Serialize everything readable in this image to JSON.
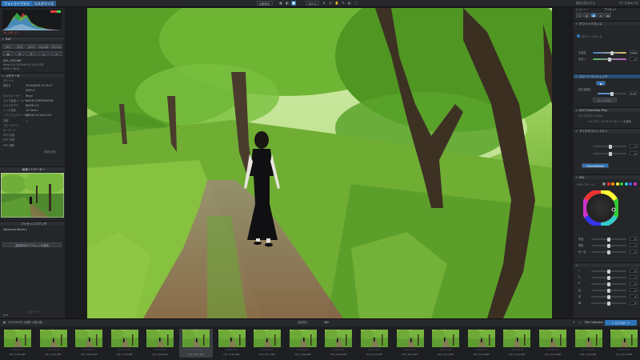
{
  "topbar": {
    "tabs": [
      "フォトライブラリ",
      "カスタマイズ"
    ],
    "ellipsis": "…",
    "toolbar_buttons": [
      "比較表示",
      "100 %"
    ],
    "zoom_label": "100 %",
    "right_tabs": [
      "補正を表示する",
      "ワークスペース"
    ],
    "icons": [
      "grid-icon",
      "compare-icon",
      "crop-icon",
      "rotate-icon",
      "hand-icon",
      "picker-icon"
    ]
  },
  "left_panel": {
    "histogram_readout": "34, 100, 17",
    "histogram_colors": [
      "#e83d3d",
      "#3ddc55",
      "#3d7de8",
      "#f0f0f0"
    ],
    "exif_section": "Exif",
    "shooting_modes": [
      "ISO 100",
      "1/13",
      "f/4.0",
      "24-105",
      "EV 0.0"
    ],
    "mode_buttons": [
      "",
      "",
      "",
      "",
      ""
    ],
    "file_name": "DSF_4701.RAF",
    "file_info": "Nikon Z 6  2019:06:14  14:12:28",
    "resolution": "6048 x 4024",
    "meta_section": "メタデータ",
    "meta_rows": [
      {
        "label": "タイトル",
        "value": ""
      },
      {
        "label": "撮影日",
        "value": "2019/06/08  15:03:17"
      },
      {
        "label": "",
        "value": "DXP+0"
      },
      {
        "label": "カメラメーカー",
        "value": "Nikon"
      },
      {
        "label": "カメラ製造メーカー",
        "value": "NIKON CORPORATION"
      },
      {
        "label": "カメラモデル",
        "value": "NIKON Z 6"
      },
      {
        "label": "レンズ名称",
        "value": "24-70mm"
      },
      {
        "label": "ソフトウェアバージョン",
        "value": "NIKON Z 6 Ver.01.00"
      },
      {
        "label": "評価",
        "value": "—"
      },
      {
        "label": "コピーライト",
        "value": ""
      },
      {
        "label": "キーワード",
        "value": ""
      },
      {
        "label": "IPTC 作者",
        "value": ""
      },
      {
        "label": "IPTC 作成",
        "value": ""
      },
      {
        "label": "IPTC 場所",
        "value": ""
      }
    ],
    "more_link": "詳細を表示",
    "navigator_title": "画像ナビゲーター",
    "preset_title": "プリセットエディタ",
    "preset_dropdown": "Advanced Helvet",
    "preset_button": "選択済みのプリセットを適用",
    "footer_tabs": [
      "Exif",
      "ヒストリー"
    ]
  },
  "right_panel": {
    "top_tabs": [
      "ヒストリー",
      "プリセット"
    ],
    "mode_tabs": [
      "",
      "",
      "",
      "",
      ""
    ],
    "sections": {
      "wb": "ホワイトバランス",
      "wb_checkbox": "ホワイトバランス",
      "wb_temp": "5400",
      "wb_tint": "0",
      "wb_labels": [
        "色温度",
        "色合い"
      ],
      "tone": "スマートライティング",
      "exposure": "露光量補正",
      "exp_value": "0.00",
      "contrast": "コントラスト",
      "highlights": "マイクロコントラスト",
      "clarity_labels": [
        "DxO ClearView Plus",
        "マイクロコントラスト",
        "シャドウ・ハイライトのトーンを保持"
      ],
      "hsl": "HSL",
      "hsl_mode": "ChannelSelect",
      "color_wheel_label": "カラーホイール",
      "hsl_sliders": [
        "彩度",
        "輝度",
        "均一性"
      ],
      "hsl_values": [
        "0",
        "0",
        "0"
      ],
      "color_sliders": [
        "L",
        "A",
        "B",
        "色",
        "彩",
        "輝"
      ],
      "color_values": [
        "0",
        "0",
        "0",
        "0",
        "0",
        "0"
      ]
    }
  },
  "filmstrip": {
    "path": "2019/06/08 大阪府 大阪公園 ...",
    "count_label": "画像表示",
    "count": "181",
    "collection_label": "Film Collection",
    "export_button": "エクスポート",
    "thumbs": [
      {
        "cap": "DSF_4700.NEF",
        "sel": false
      },
      {
        "cap": "DSF_4701.NEF",
        "sel": false
      },
      {
        "cap": "DSF_4702.NEF",
        "sel": false
      },
      {
        "cap": "DSF_4703.NEF",
        "sel": false
      },
      {
        "cap": "DSF_4704.NEF",
        "sel": false
      },
      {
        "cap": "DSF_4705.NEF",
        "sel": true
      },
      {
        "cap": "DSF_4706.NEF",
        "sel": false
      },
      {
        "cap": "DSF_4707.NEF",
        "sel": false
      },
      {
        "cap": "DSF_4708.NEF",
        "sel": false
      },
      {
        "cap": "DSF_4709.NEF",
        "sel": false
      },
      {
        "cap": "DSF_4710.NEF",
        "sel": false
      },
      {
        "cap": "DSF_4711.NEF",
        "sel": false
      },
      {
        "cap": "DSF_4712.NEF",
        "sel": false
      },
      {
        "cap": "DSF_4713.NEF",
        "sel": false
      },
      {
        "cap": "DSF_4714.NEF",
        "sel": false
      },
      {
        "cap": "DSF_4715.NEF",
        "sel": false
      },
      {
        "cap": "DSF_4716.NEF",
        "sel": false
      },
      {
        "cap": "DSF_4717.NEF",
        "sel": false
      }
    ],
    "stars": "★★★★★"
  },
  "accent": "#2e74b8"
}
